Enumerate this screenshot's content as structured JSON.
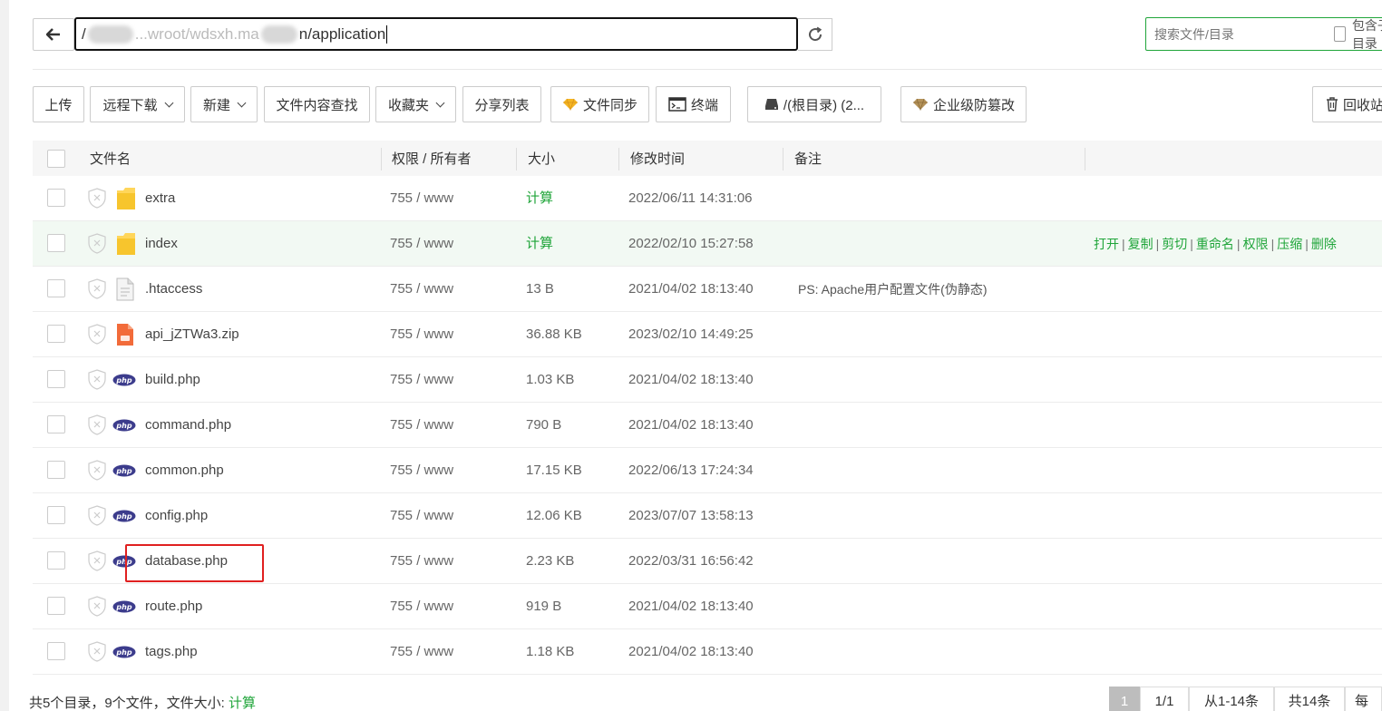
{
  "path_bar": {
    "path_start": "/",
    "path_partial_1": "...wroot/wdsxh.ma",
    "path_partial_2": "n/application",
    "search_placeholder": "搜索文件/目录",
    "search_sub_label": "包含子目录"
  },
  "toolbar": {
    "upload": "上传",
    "remote_download": "远程下载",
    "new": "新建",
    "content_search": "文件内容查找",
    "favorites": "收藏夹",
    "share_list": "分享列表",
    "file_sync": "文件同步",
    "terminal": "终端",
    "disk": "/(根目录) (2...",
    "anti_tamper": "企业级防篡改",
    "recycle": "回收站"
  },
  "columns": {
    "name": "文件名",
    "perm": "权限 / 所有者",
    "size": "大小",
    "mtime": "修改时间",
    "note": "备注"
  },
  "rows": [
    {
      "name": "extra",
      "type": "folder",
      "perm": "755 / www",
      "size": "计算",
      "mtime": "2022/06/11 14:31:06",
      "note": ""
    },
    {
      "name": "index",
      "type": "folder",
      "perm": "755 / www",
      "size": "计算",
      "mtime": "2022/02/10 15:27:58",
      "note": ""
    },
    {
      "name": ".htaccess",
      "type": "file",
      "perm": "755 / www",
      "size": "13 B",
      "mtime": "2021/04/02 18:13:40",
      "note": "PS: Apache用户配置文件(伪静态)"
    },
    {
      "name": "api_jZTWa3.zip",
      "type": "zip",
      "perm": "755 / www",
      "size": "36.88 KB",
      "mtime": "2023/02/10 14:49:25",
      "note": ""
    },
    {
      "name": "build.php",
      "type": "php",
      "perm": "755 / www",
      "size": "1.03 KB",
      "mtime": "2021/04/02 18:13:40",
      "note": ""
    },
    {
      "name": "command.php",
      "type": "php",
      "perm": "755 / www",
      "size": "790 B",
      "mtime": "2021/04/02 18:13:40",
      "note": ""
    },
    {
      "name": "common.php",
      "type": "php",
      "perm": "755 / www",
      "size": "17.15 KB",
      "mtime": "2022/06/13 17:24:34",
      "note": ""
    },
    {
      "name": "config.php",
      "type": "php",
      "perm": "755 / www",
      "size": "12.06 KB",
      "mtime": "2023/07/07 13:58:13",
      "note": ""
    },
    {
      "name": "database.php",
      "type": "php",
      "perm": "755 / www",
      "size": "2.23 KB",
      "mtime": "2022/03/31 16:56:42",
      "note": ""
    },
    {
      "name": "route.php",
      "type": "php",
      "perm": "755 / www",
      "size": "919 B",
      "mtime": "2021/04/02 18:13:40",
      "note": ""
    },
    {
      "name": "tags.php",
      "type": "php",
      "perm": "755 / www",
      "size": "1.18 KB",
      "mtime": "2021/04/02 18:13:40",
      "note": ""
    }
  ],
  "row_actions": [
    "打开",
    "复制",
    "剪切",
    "重命名",
    "权限",
    "压缩",
    "删除"
  ],
  "footer": {
    "summary": "共5个目录，9个文件，文件大小:",
    "calc": "计算",
    "page_current": "1",
    "page_of": "1/1",
    "range": "从1-14条",
    "total": "共14条",
    "per_page": "每页"
  },
  "colors": {
    "accent": "#20a53a",
    "highlight_box": "#e02020"
  }
}
